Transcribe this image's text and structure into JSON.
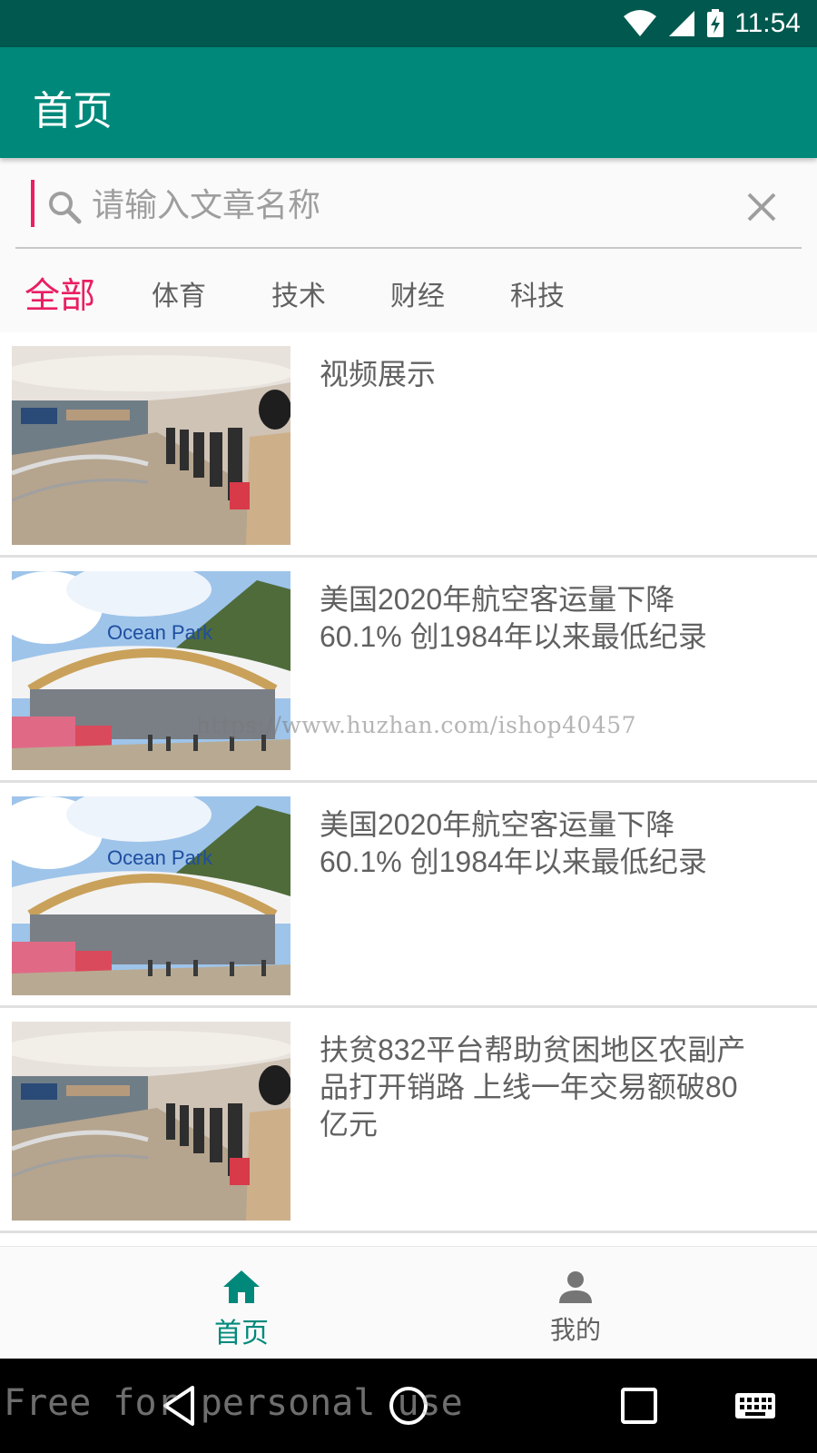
{
  "status_bar": {
    "time": "11:54",
    "icons": [
      "wifi-icon",
      "cellular-signal-icon",
      "battery-charging-icon"
    ]
  },
  "app_bar": {
    "title": "首页"
  },
  "search": {
    "placeholder": "请输入文章名称",
    "value": ""
  },
  "tabs": [
    {
      "label": "全部",
      "active": true
    },
    {
      "label": "体育",
      "active": false
    },
    {
      "label": "技术",
      "active": false
    },
    {
      "label": "财经",
      "active": false
    },
    {
      "label": "科技",
      "active": false
    }
  ],
  "news": [
    {
      "title": "视频展示",
      "thumbnail": "mall-queue"
    },
    {
      "title": "美国2020年航空客运量下降60.1% 创1984年以来最低纪录",
      "thumbnail": "ocean-park"
    },
    {
      "title": "美国2020年航空客运量下降60.1% 创1984年以来最低纪录",
      "thumbnail": "ocean-park"
    },
    {
      "title": "扶贫832平台帮助贫困地区农副产品打开销路 上线一年交易额破80亿元",
      "thumbnail": "mall-queue"
    }
  ],
  "watermark": {
    "url": "https://www.huzhan.com/ishop40457",
    "free_text": "Free for personal use"
  },
  "bottom_nav": {
    "items": [
      {
        "label": "首页",
        "icon": "home-icon",
        "active": true
      },
      {
        "label": "我的",
        "icon": "person-icon",
        "active": false
      }
    ]
  },
  "colors": {
    "primary": "#00897b",
    "primary_dark": "#00584f",
    "accent": "#e91e63"
  }
}
